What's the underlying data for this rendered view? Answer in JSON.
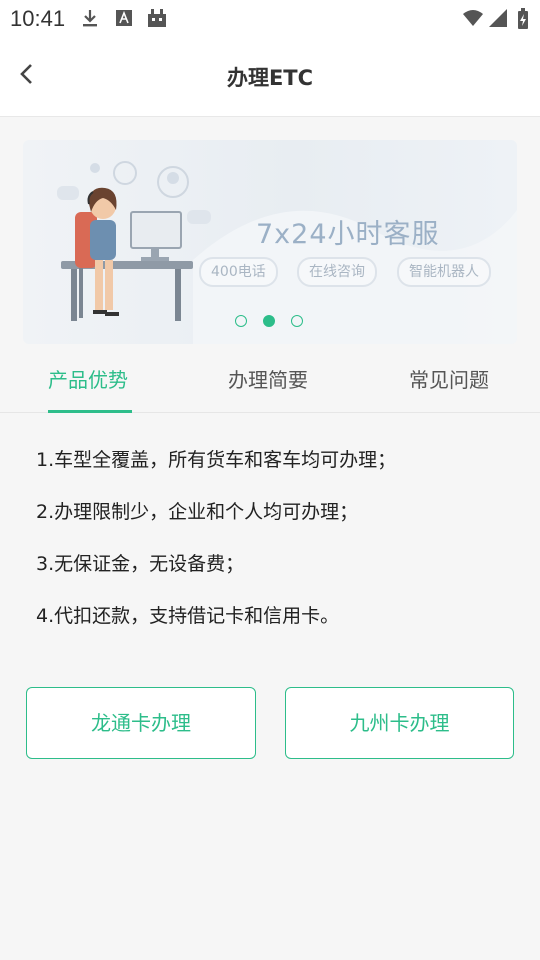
{
  "status_bar": {
    "time": "10:41"
  },
  "header": {
    "title": "办理ETC"
  },
  "banner": {
    "heading": "7x24小时客服",
    "pills": [
      "400电话",
      "在线咨询",
      "智能机器人"
    ],
    "active_dot": 2
  },
  "tabs": [
    {
      "label": "产品优势",
      "active": true
    },
    {
      "label": "办理简要",
      "active": false
    },
    {
      "label": "常见问题",
      "active": false
    }
  ],
  "advantages": [
    "1.车型全覆盖，所有货车和客车均可办理；",
    "2.办理限制少，企业和个人均可办理；",
    "3.无保证金，无设备费；",
    "4.代扣还款，支持借记卡和信用卡。"
  ],
  "buttons": {
    "longtong": "龙通卡办理",
    "jiuzhou": "九州卡办理"
  },
  "colors": {
    "accent": "#2dbd8a"
  }
}
